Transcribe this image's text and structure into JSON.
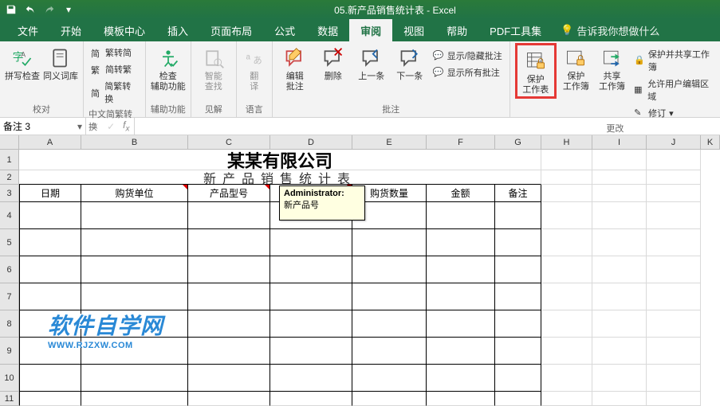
{
  "titlebar": {
    "title": "05.新产品销售统计表 - Excel"
  },
  "tabs": {
    "file": "文件",
    "home": "开始",
    "template": "模板中心",
    "insert": "插入",
    "layout": "页面布局",
    "formula": "公式",
    "data": "数据",
    "review": "审阅",
    "view": "视图",
    "help": "帮助",
    "pdf": "PDF工具集",
    "tellme": "告诉我你想做什么"
  },
  "ribbon": {
    "proofing": {
      "spell": "拼写检查",
      "thesaurus": "同义词库",
      "label": "校对"
    },
    "chinese": {
      "simp2trad": "繁转简",
      "trad2simp": "简转繁",
      "convert": "简繁转换",
      "label": "中文简繁转换"
    },
    "accessibility": {
      "check": "检查\n辅助功能",
      "label": "辅助功能"
    },
    "insights": {
      "smart": "智能\n查找",
      "label": "见解"
    },
    "language": {
      "translate": "翻\n译",
      "label": "语言"
    },
    "comments": {
      "edit": "编辑\n批注",
      "delete": "删除",
      "prev": "上一条",
      "next": "下一条",
      "showhide": "显示/隐藏批注",
      "showall": "显示所有批注",
      "label": "批注"
    },
    "protect": {
      "sheet": "保护\n工作表",
      "workbook": "保护\n工作簿",
      "share": "共享\n工作簿",
      "protectshare": "保护并共享工作簿",
      "allowedit": "允许用户编辑区域",
      "revisions": "修订",
      "label": "更改"
    }
  },
  "namebox": "备注 3",
  "sheet": {
    "cols": [
      "A",
      "B",
      "C",
      "D",
      "E",
      "F",
      "G",
      "H",
      "I",
      "J",
      "K"
    ],
    "rownums": [
      "1",
      "2",
      "3",
      "4",
      "5",
      "6",
      "7",
      "8",
      "9",
      "10",
      "11"
    ],
    "company": "某某有限公司",
    "subtitle": "新产品销售统计表",
    "headers": {
      "date": "日期",
      "customer": "购货单位",
      "model": "产品型号",
      "qty": "购货数量",
      "amount": "金额",
      "remark": "备注"
    },
    "comment": {
      "author": "Administrator:",
      "text": "新产品号"
    }
  },
  "watermark": {
    "main": "软件自学网",
    "sub": "WWW.RJZXW.COM"
  }
}
